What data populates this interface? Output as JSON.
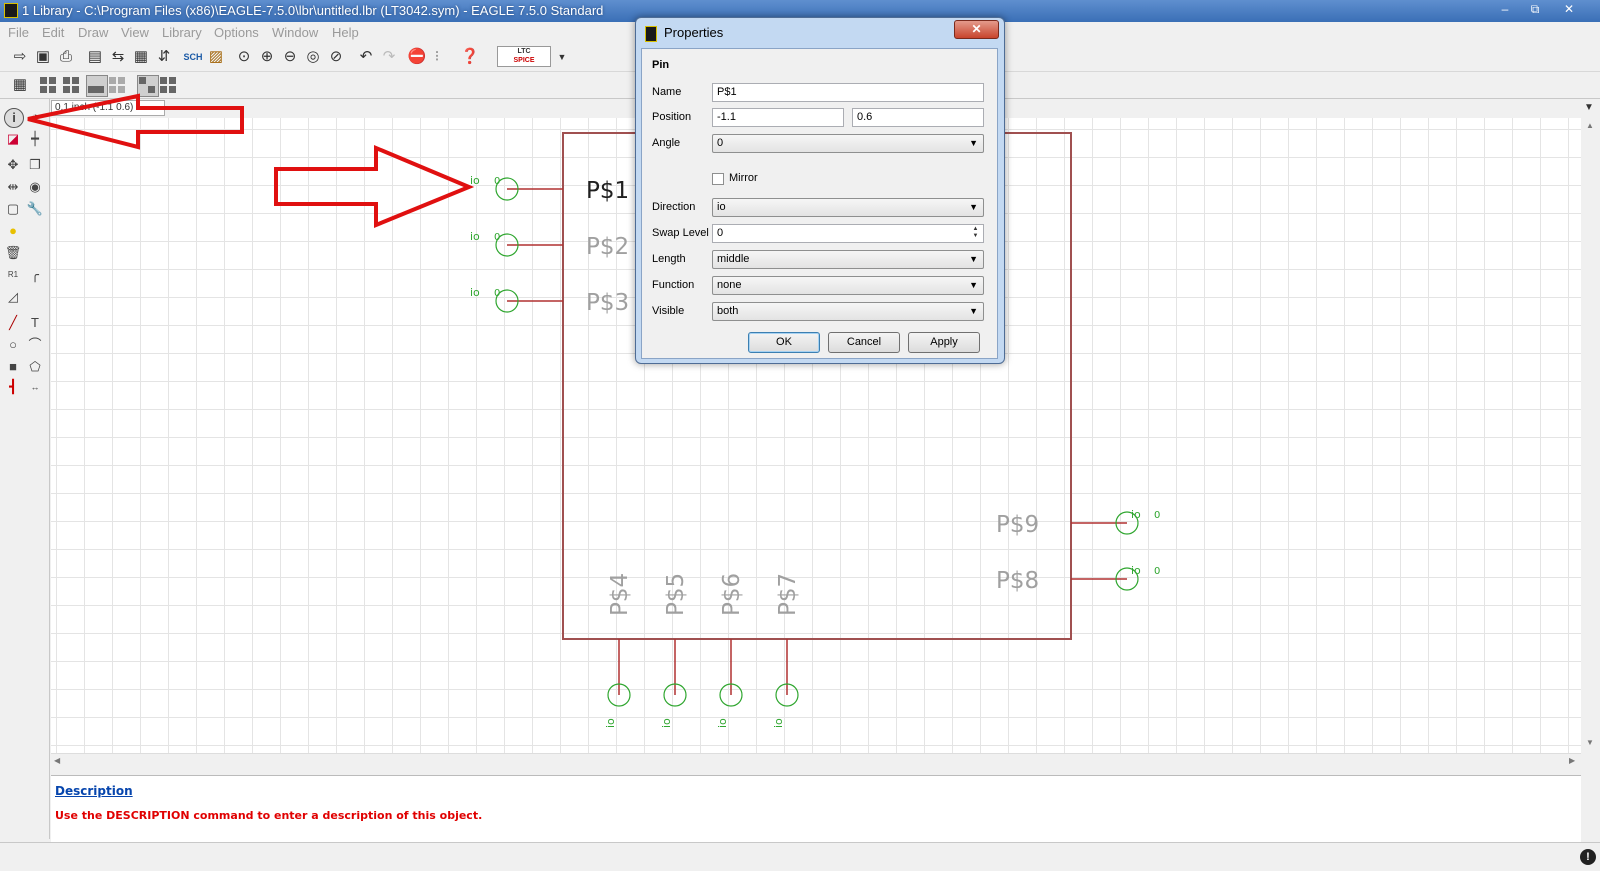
{
  "window": {
    "title": "1 Library - C:\\Program Files (x86)\\EAGLE-7.5.0\\lbr\\untitled.lbr (LT3042.sym) - EAGLE 7.5.0 Standard",
    "minimize": "–",
    "maximize": "⧉",
    "close": "✕"
  },
  "menu": [
    "File",
    "Edit",
    "Draw",
    "View",
    "Library",
    "Options",
    "Window",
    "Help"
  ],
  "toolbar": {
    "ltspice_top": "LTC",
    "ltspice_bottom": "SPICE",
    "sch_label": "SCH"
  },
  "coords": "0.1 inch (-1.1 0.6)",
  "symbol": {
    "pins_left": [
      "P$1",
      "P$2",
      "P$3"
    ],
    "pins_bottom": [
      "P$4",
      "P$5",
      "P$6",
      "P$7"
    ],
    "pins_right": [
      "P$9",
      "P$8"
    ],
    "pin_direction_label": "io",
    "pin_swap_label": "0"
  },
  "dialog": {
    "title": "Properties",
    "close": "✕",
    "section": "Pin",
    "name_label": "Name",
    "name_value": "P$1",
    "position_label": "Position",
    "position_x": "-1.1",
    "position_y": "0.6",
    "angle_label": "Angle",
    "angle_value": "0",
    "mirror_label": "Mirror",
    "direction_label": "Direction",
    "direction_value": "io",
    "swap_label": "Swap Level",
    "swap_value": "0",
    "length_label": "Length",
    "length_value": "middle",
    "function_label": "Function",
    "function_value": "none",
    "visible_label": "Visible",
    "visible_value": "both",
    "ok": "OK",
    "cancel": "Cancel",
    "apply": "Apply"
  },
  "description": {
    "title": "Description",
    "text": "Use the DESCRIPTION command to enter a description of this object."
  },
  "status": {
    "icon": "!"
  },
  "colors": {
    "body_outline": "#a05050",
    "pin_circle": "#2fa62f",
    "annotation_arrow": "#e01010",
    "description_text": "#e00000"
  }
}
